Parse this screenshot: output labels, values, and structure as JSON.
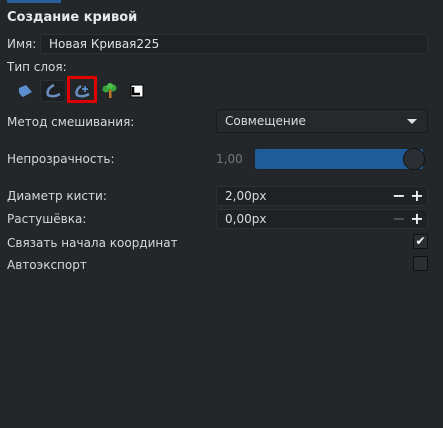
{
  "title": "Создание кривой",
  "name": {
    "label": "Имя:",
    "value": "Новая Кривая225"
  },
  "layer_type": {
    "label": "Тип слоя:",
    "icons": [
      "region-icon",
      "outline-icon",
      "advanced-outline-icon",
      "plant-icon",
      "curve-gradient-icon"
    ],
    "selected": "outline-icon",
    "highlighted": "advanced-outline-icon"
  },
  "blend": {
    "label": "Метод смешивания:",
    "value": "Совмещение"
  },
  "opacity": {
    "label": "Непрозрачность:",
    "value": "1,00",
    "fraction": 1.0
  },
  "brush": {
    "label": "Диаметр кисти:",
    "value": "2,00px"
  },
  "feather": {
    "label": "Растушёвка:",
    "value": "0,00px"
  },
  "link_origins": {
    "label": "Связать начала координат",
    "checked": true
  },
  "autoexport": {
    "label": "Автоэкспорт",
    "checked": false
  },
  "spin_minus": "−",
  "spin_plus": "+",
  "check_mark": "✔",
  "colors": {
    "accent": "#1f5b9b",
    "highlight": "#e00000",
    "background": "#23272a"
  }
}
